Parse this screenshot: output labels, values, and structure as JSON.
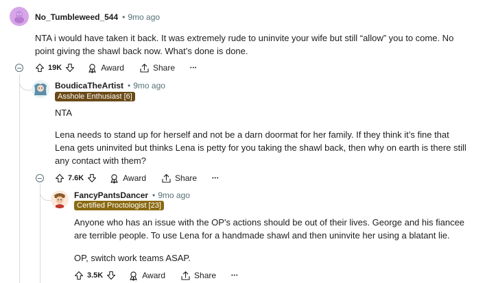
{
  "comments": [
    {
      "username": "No_Tumbleweed_544",
      "time": "9mo ago",
      "flair": "",
      "body": [
        "NTA i would have taken it back. It was extremely rude to uninvite your wife but still “allow” you to come. No point giving the shawl back now. What’s done is done."
      ],
      "votes": "19K",
      "award": "Award",
      "share": "Share",
      "more": "•••"
    },
    {
      "username": "BoudicaTheArtist",
      "time": "9mo ago",
      "flair": "Asshole Enthusiast [6]",
      "body": [
        "NTA",
        "Lena needs to stand up for herself and not be a darn doormat for her family. If they think it’s fine that Lena gets uninvited but thinks Lena is petty for you taking the shawl back, then why on earth is there still any contact with them?"
      ],
      "votes": "7.6K",
      "award": "Award",
      "share": "Share",
      "more": "•••"
    },
    {
      "username": "FancyPantsDancer",
      "time": "9mo ago",
      "flair": "Certified Proctologist [23]",
      "body": [
        "Anyone who has an issue with the OP's actions should be out of their lives. George and his fiancee are terrible people. To use Lena for a handmade shawl and then uninvite her using a blatant lie.",
        "OP, switch work teams ASAP."
      ],
      "votes": "3.5K",
      "award": "Award",
      "share": "Share",
      "more": "•••"
    }
  ],
  "meta_separator": "•",
  "colors": {
    "flair_1": "#6b4a17",
    "flair_2": "#8a6a12",
    "avatar_1": "#d7a6e8",
    "thread_line": "#d6dadc",
    "meta": "#576f76"
  }
}
